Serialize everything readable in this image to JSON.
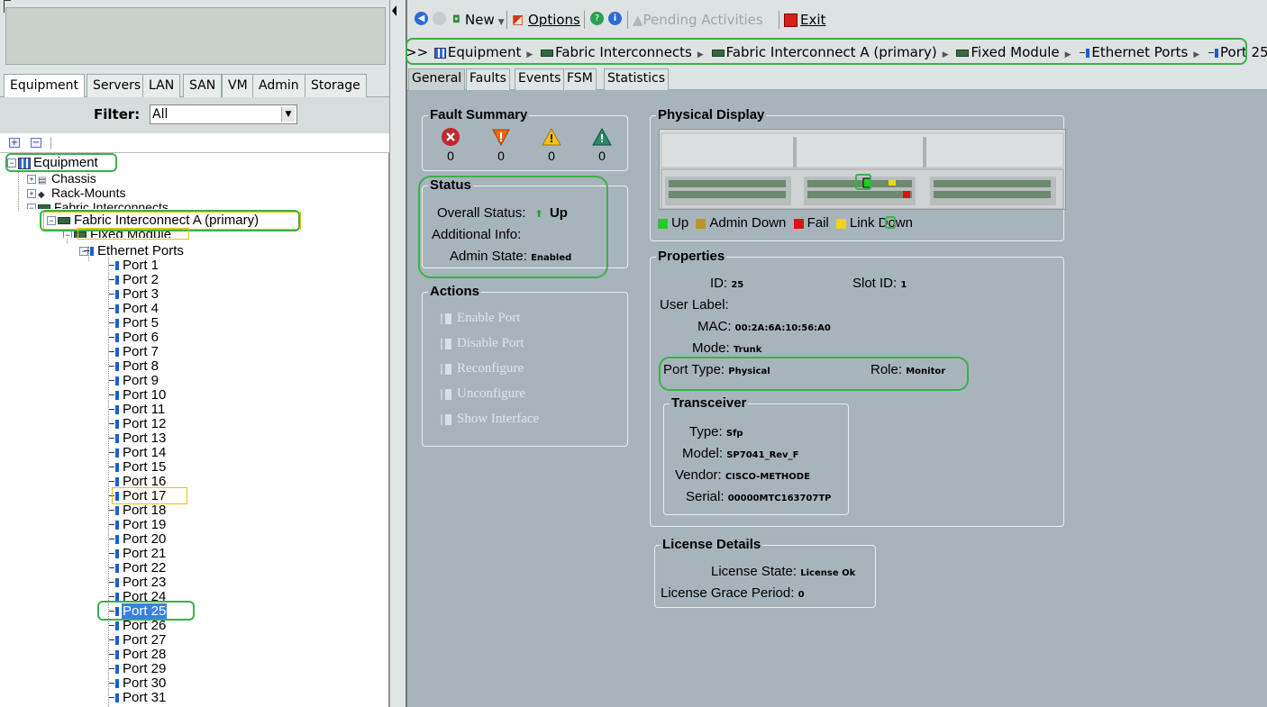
{
  "left": {
    "tabs": [
      "Equipment",
      "Servers",
      "LAN",
      "SAN",
      "VM",
      "Admin",
      "Storage"
    ],
    "filter_label": "Filter:",
    "filter_value": "All",
    "tree": {
      "equipment": "Equipment",
      "chassis": "Chassis",
      "rack_mounts": "Rack-Mounts",
      "fabric_interconnects": "Fabric Interconnects",
      "fi_a": "Fabric Interconnect A (primary)",
      "fixed_module": "Fixed Module",
      "ethernet_ports": "Ethernet Ports",
      "ports": [
        "Port 1",
        "Port 2",
        "Port 3",
        "Port 4",
        "Port 5",
        "Port 6",
        "Port 7",
        "Port 8",
        "Port 9",
        "Port 10",
        "Port 11",
        "Port 12",
        "Port 13",
        "Port 14",
        "Port 15",
        "Port 16",
        "Port 17",
        "Port 18",
        "Port 19",
        "Port 20",
        "Port 21",
        "Port 22",
        "Port 23",
        "Port 24",
        "Port 25",
        "Port 26",
        "Port 27",
        "Port 28",
        "Port 29",
        "Port 30",
        "Port 31"
      ]
    }
  },
  "toolbar": {
    "new": "New",
    "options": "Options",
    "pending": "Pending Activities",
    "exit": "Exit"
  },
  "breadcrumb": {
    "prefix": ">>",
    "items": [
      "Equipment",
      "Fabric Interconnects",
      "Fabric Interconnect A (primary)",
      "Fixed Module",
      "Ethernet Ports",
      "Port 25"
    ]
  },
  "content_tabs": [
    "General",
    "Faults",
    "Events",
    "FSM",
    "Statistics"
  ],
  "fault_summary": {
    "title": "Fault Summary",
    "counts": [
      "0",
      "0",
      "0",
      "0"
    ],
    "colors": [
      "#c0282d",
      "#e86a12",
      "#f0c020",
      "#2a8a6a"
    ]
  },
  "status": {
    "title": "Status",
    "overall_label": "Overall Status:",
    "overall_value": "Up",
    "additional_label": "Additional Info:",
    "admin_label": "Admin State:",
    "admin_value": "Enabled"
  },
  "actions": {
    "title": "Actions",
    "items": [
      "Enable Port",
      "Disable Port",
      "Reconfigure",
      "Unconfigure",
      "Show Interface"
    ]
  },
  "physical_display": {
    "title": "Physical Display",
    "legend": [
      {
        "label": "Up",
        "color": "#22cc22"
      },
      {
        "label": "Admin Down",
        "color": "#b8962a"
      },
      {
        "label": "Fail",
        "color": "#e01010"
      },
      {
        "label": "Link Down",
        "color": "#f2d21a"
      }
    ]
  },
  "properties": {
    "title": "Properties",
    "id_label": "ID:",
    "id_value": "25",
    "slot_label": "Slot ID:",
    "slot_value": "1",
    "user_label": "User Label:",
    "mac_label": "MAC:",
    "mac_value": "00:2A:6A:10:56:A0",
    "mode_label": "Mode:",
    "mode_value": "Trunk",
    "port_type_label": "Port Type:",
    "port_type_value": "Physical",
    "role_label": "Role:",
    "role_value": "Monitor"
  },
  "transceiver": {
    "title": "Transceiver",
    "type_label": "Type:",
    "type_value": "Sfp",
    "model_label": "Model:",
    "model_value": "SP7041_Rev_F",
    "vendor_label": "Vendor:",
    "vendor_value": "CISCO-METHODE",
    "serial_label": "Serial:",
    "serial_value": "00000MTC163707TP"
  },
  "license": {
    "title": "License Details",
    "state_label": "License State:",
    "state_value": "License Ok",
    "grace_label": "License Grace Period:",
    "grace_value": "0"
  },
  "colors": {
    "highlight_green": "#3cb04a",
    "highlight_yellow": "#e8c010",
    "content_bg": "#a8b4bc",
    "selection": "#3b7fe0"
  }
}
